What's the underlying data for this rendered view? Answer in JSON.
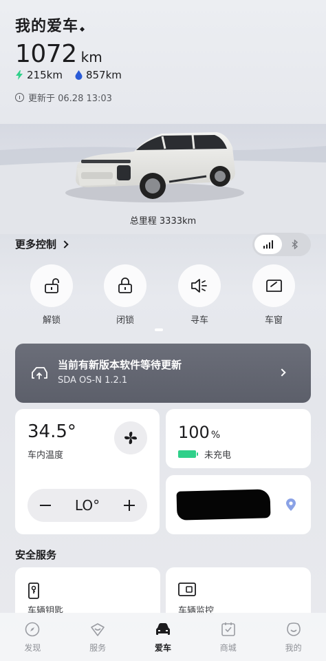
{
  "header": {
    "title": "我的爱车",
    "range_value": "1072",
    "range_unit": "km",
    "electric_range": "215km",
    "fuel_range": "857km",
    "updated_text": "更新于 06.28 13:03"
  },
  "vehicle": {
    "odometer_text": "总里程 3333km"
  },
  "controls": {
    "more_label": "更多控制",
    "connection_options": [
      "cellular-signal-icon",
      "bluetooth-icon"
    ],
    "connection_selected": "cellular",
    "quick_actions": [
      {
        "label": "解锁",
        "icon": "unlock-icon"
      },
      {
        "label": "闭锁",
        "icon": "lock-icon"
      },
      {
        "label": "寻车",
        "icon": "horn-icon"
      },
      {
        "label": "车窗",
        "icon": "window-icon"
      }
    ]
  },
  "update_banner": {
    "title": "当前有新版本软件等待更新",
    "version": "SDA OS-N 1.2.1"
  },
  "climate": {
    "temperature": "34.5°",
    "label": "车内温度",
    "setpoint": "LO°"
  },
  "battery": {
    "value": "100",
    "unit": "%",
    "status": "未充电",
    "level": 1.0
  },
  "security": {
    "title": "安全服务",
    "items": [
      {
        "label": "车辆钥匙",
        "icon": "car-key-icon"
      },
      {
        "label": "车辆监控",
        "icon": "monitor-icon"
      }
    ]
  },
  "tabbar": {
    "items": [
      {
        "label": "发现",
        "icon": "compass-icon"
      },
      {
        "label": "服务",
        "icon": "heart-service-icon"
      },
      {
        "label": "爱车",
        "icon": "car-icon"
      },
      {
        "label": "商城",
        "icon": "shop-icon"
      },
      {
        "label": "我的",
        "icon": "profile-icon"
      }
    ],
    "active": "爱车"
  },
  "colors": {
    "accent_green": "#2fd08a",
    "fuel_blue": "#2a5bd7",
    "banner": "#62656f",
    "pin": "#8aa2e6"
  }
}
